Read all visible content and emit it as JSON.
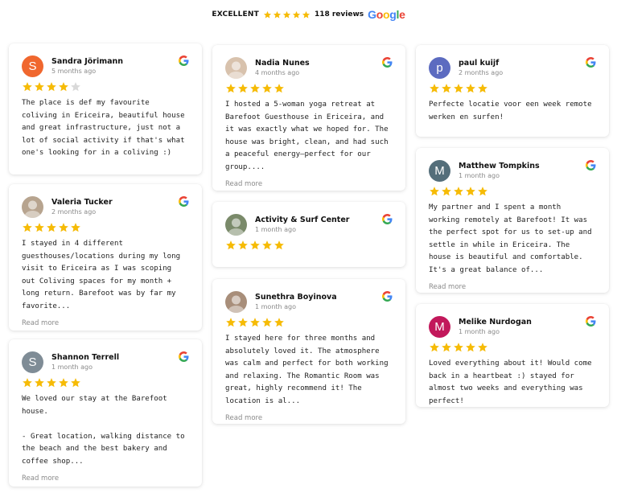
{
  "summary": {
    "label": "EXCELLENT",
    "rating": 5,
    "count_text": "118 reviews",
    "brand": "Google"
  },
  "colors": {
    "star": "#f6bb06",
    "star_empty": "#d9d9d9",
    "google_blue": "#4285F4",
    "google_red": "#EA4335",
    "google_yellow": "#FBBC05",
    "google_green": "#34A853"
  },
  "read_more_label": "Read more",
  "reviews": [
    {
      "name": "Sandra Jörimann",
      "ago": "5 months ago",
      "rating": 4,
      "avatar_letter": "S",
      "avatar_color": "#f0672e",
      "text": "The place is def my favourite coliving in Ericeira, beautiful house and great infrastructure, just not a lot of social activity if that's what one's looking for in a coliving :)",
      "read_more": false
    },
    {
      "name": "Valeria Tucker",
      "ago": "2 months ago",
      "rating": 5,
      "avatar_letter": "",
      "avatar_color": "#b7a48f",
      "text": "I stayed in 4 different guesthouses/locations during my long visit to Ericeira as I was scoping out Coliving spaces for my month + long return. Barefoot was by far my favorite...",
      "read_more": true
    },
    {
      "name": "Shannon Terrell",
      "ago": "1 month ago",
      "rating": 5,
      "avatar_letter": "S",
      "avatar_color": "#7f8c96",
      "text": "We loved our stay at the Barefoot house.\n\n- Great location, walking distance to the beach and the best bakery and coffee shop...",
      "read_more": true
    },
    {
      "name": "Nadia Nunes",
      "ago": "4 months ago",
      "rating": 5,
      "avatar_letter": "",
      "avatar_color": "#d8c2ad",
      "text": "I hosted a 5-woman yoga retreat at Barefoot Guesthouse in Ericeira, and it was exactly what we hoped for. The house was bright, clean, and had such a peaceful energy—perfect for our group....",
      "read_more": true
    },
    {
      "name": "Activity & Surf Center",
      "ago": "1 month ago",
      "rating": 5,
      "avatar_letter": "",
      "avatar_color": "#7a8a6a",
      "text": "",
      "read_more": false
    },
    {
      "name": "Sunethra Boyinova",
      "ago": "1 month ago",
      "rating": 5,
      "avatar_letter": "",
      "avatar_color": "#a88e7a",
      "text": "I stayed here for three months and absolutely loved it. The atmosphere was calm and perfect for both working and relaxing. The Romantic Room was great, highly recommend it! The location is al...",
      "read_more": true
    },
    {
      "name": "paul kuijf",
      "ago": "2 months ago",
      "rating": 5,
      "avatar_letter": "p",
      "avatar_color": "#5c6bc0",
      "text": "Perfecte locatie voor een week remote werken en surfen!",
      "read_more": false
    },
    {
      "name": "Matthew Tompkins",
      "ago": "1 month ago",
      "rating": 5,
      "avatar_letter": "M",
      "avatar_color": "#546e7a",
      "text": "My partner and I spent a month working remotely at Barefoot! It was the perfect spot for us to set-up and settle in while in Ericeira. The house is beautiful and comfortable. It's a great balance of...",
      "read_more": true
    },
    {
      "name": "Melike Nurdogan",
      "ago": "1 month ago",
      "rating": 5,
      "avatar_letter": "M",
      "avatar_color": "#c2185b",
      "text": "Loved everything about it! Would come back in a heartbeat :) stayed for almost two weeks and everything was perfect!",
      "read_more": false
    }
  ]
}
